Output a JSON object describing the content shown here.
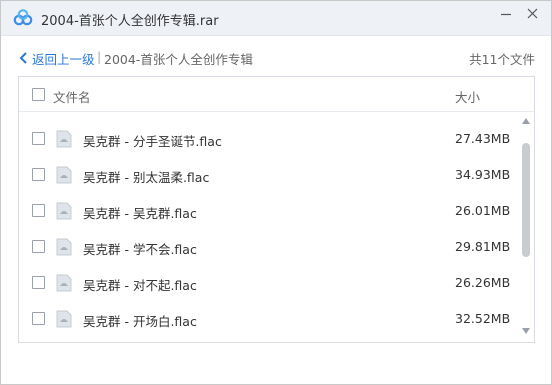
{
  "window": {
    "title": "2004-首张个人全创作专辑.rar",
    "minimize_icon": "minimize-icon",
    "close_icon": "close-icon",
    "logo_icon": "baidu-netdisk-logo-icon",
    "accent_color": "#2b78d8"
  },
  "nav": {
    "back_label": "返回上一级",
    "separator": "|",
    "current_folder": "2004-首张个人全创作专辑",
    "file_count": "共11个文件"
  },
  "list": {
    "header": {
      "name": "文件名",
      "size": "大小"
    },
    "files": [
      {
        "name": "吴克群 - 分手圣诞节.flac",
        "size": "27.43MB"
      },
      {
        "name": "吴克群 - 别太温柔.flac",
        "size": "34.93MB"
      },
      {
        "name": "吴克群 - 吴克群.flac",
        "size": "26.01MB"
      },
      {
        "name": "吴克群 - 学不会.flac",
        "size": "29.81MB"
      },
      {
        "name": "吴克群 - 对不起.flac",
        "size": "26.26MB"
      },
      {
        "name": "吴克群 - 开场白.flac",
        "size": "32.52MB"
      }
    ]
  }
}
